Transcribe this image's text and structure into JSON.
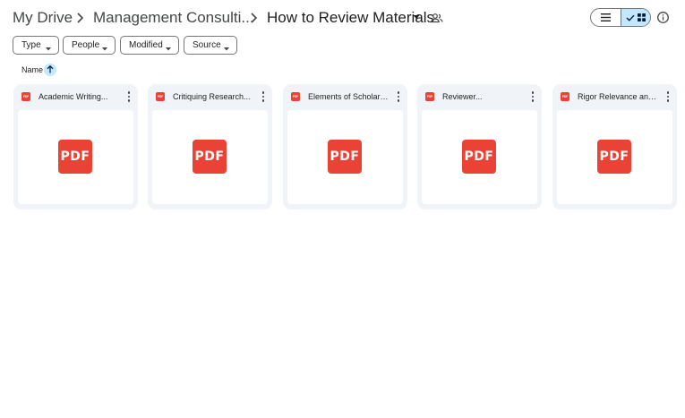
{
  "breadcrumb": {
    "items": [
      "My Drive",
      "Management Consulti...",
      "How to Review Materials"
    ]
  },
  "icons": {
    "separator": "chevron-right-icon",
    "current_dropdown": "arrow-drop-down-icon",
    "shared": "people-icon",
    "list_view": "list-view-icon",
    "grid_view": "grid-view-icon",
    "info": "info-icon",
    "sort": "arrow-upward-icon",
    "file_type": "pdf-icon",
    "more": "more-vert-icon"
  },
  "filters": [
    {
      "label": "Type"
    },
    {
      "label": "People"
    },
    {
      "label": "Modified"
    },
    {
      "label": "Source"
    }
  ],
  "sort": {
    "label": "Name",
    "direction": "ascending"
  },
  "files": [
    {
      "name": "Academic Writing...",
      "thumb_label": "PDF"
    },
    {
      "name": "Critiquing Research...",
      "thumb_label": "PDF"
    },
    {
      "name": "Elements of Scholarl...",
      "thumb_label": "PDF"
    },
    {
      "name": "Reviewer...",
      "thumb_label": "PDF"
    },
    {
      "name": "Rigor Relevance and...",
      "thumb_label": "PDF"
    }
  ],
  "colors": {
    "pdf_red": "#ea4335",
    "active_toggle": "#c2e7ff",
    "card_bg": "#f0f4f9"
  }
}
